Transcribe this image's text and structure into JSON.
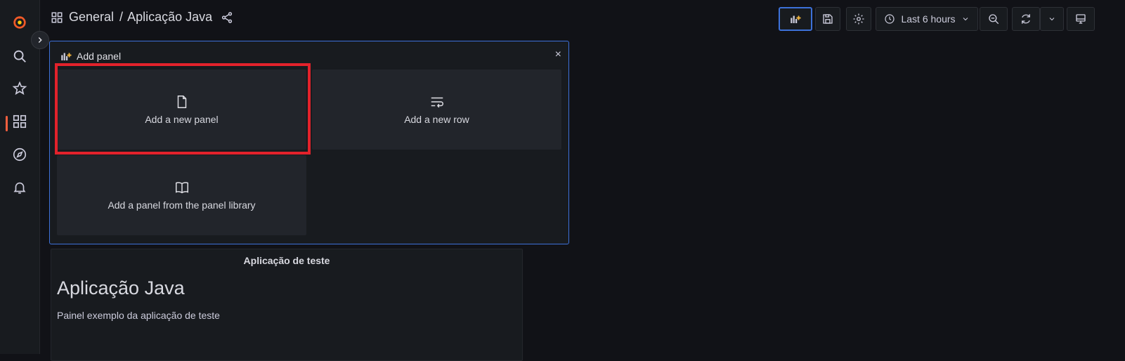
{
  "breadcrumb": {
    "folder": "General",
    "separator": "/",
    "dashboard": "Aplicação Java"
  },
  "toolbar": {
    "time_range": "Last 6 hours",
    "add_panel_icon": "add-panel-icon",
    "save_icon": "save-icon",
    "settings_icon": "gear-icon",
    "zoom_out_icon": "zoom-out-icon",
    "refresh_icon": "refresh-icon",
    "tv_mode_icon": "monitor-icon"
  },
  "sidemenu": {
    "items": [
      "grafana-logo",
      "search-icon",
      "star-icon",
      "dashboards-icon",
      "explore-icon",
      "alerting-icon"
    ],
    "active_color": "#f55f3e"
  },
  "add_panel": {
    "title": "Add panel",
    "close": "×",
    "options": {
      "new_panel": "Add a new panel",
      "new_row": "Add a new row",
      "library": "Add a panel from the panel library"
    }
  },
  "text_panel": {
    "title": "Aplicação de teste",
    "heading": "Aplicação Java",
    "body": "Painel exemplo da aplicação de teste"
  },
  "colors": {
    "accent": "#3d71d9",
    "highlight": "#e3222b",
    "brand_orange": "#f05a28"
  }
}
